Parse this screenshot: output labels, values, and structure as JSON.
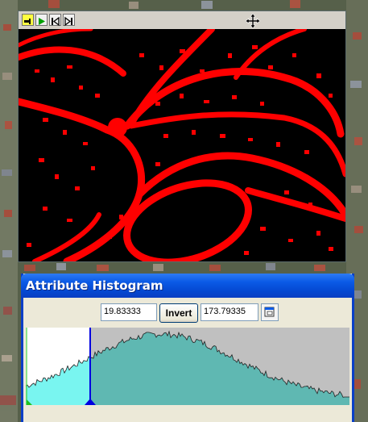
{
  "dialog": {
    "title": "Attribute Histogram",
    "min_value": "19.83333",
    "invert_label": "Invert",
    "max_value": "173.79335"
  },
  "toolbar": {
    "icons": [
      "pin-icon",
      "play-icon",
      "step-back-icon",
      "step-forward-icon",
      "move-icon"
    ]
  },
  "colors": {
    "selected_fill": "#79f5f0",
    "unselected_fill": "#5fb8b2",
    "unselected_bg": "#c0c0c0",
    "selected_bg": "#ffffff",
    "threshold_line": "#0000e0",
    "mask": "#ff0000",
    "title_bar": "#0b5ae6"
  }
}
